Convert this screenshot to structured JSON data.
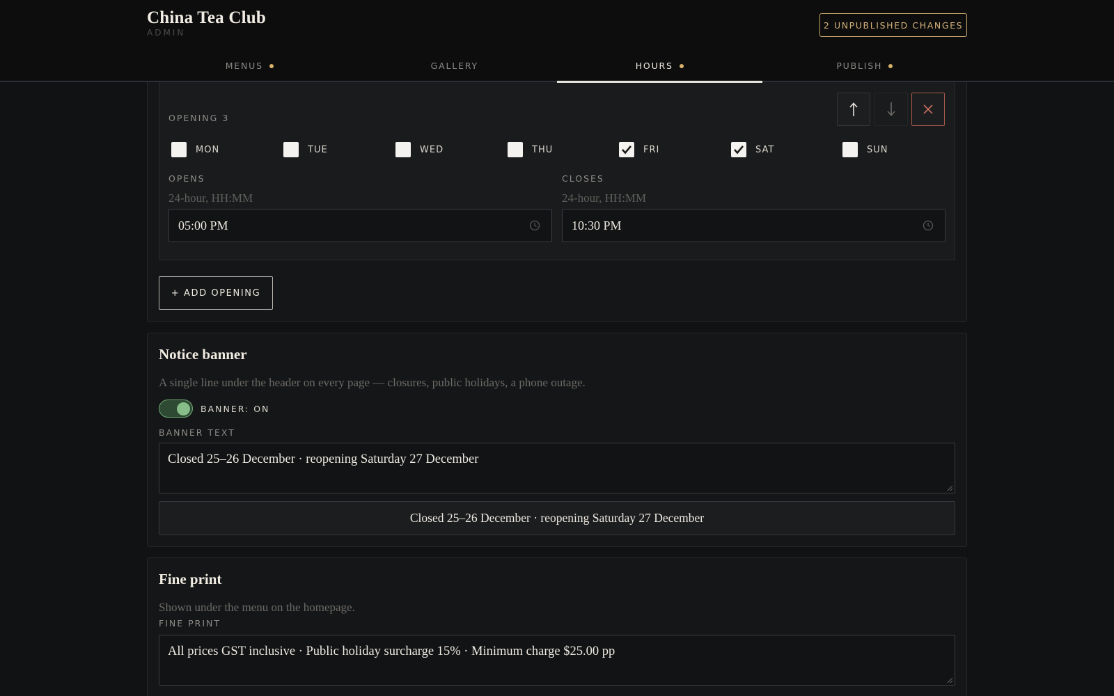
{
  "header": {
    "title": "China Tea Club",
    "subtitle": "ADMIN",
    "unpublished_label": "2 UNPUBLISHED CHANGES"
  },
  "tabs": [
    {
      "label": "MENUS",
      "has_changes": true
    },
    {
      "label": "GALLERY",
      "has_changes": false
    },
    {
      "label": "HOURS",
      "has_changes": true,
      "active": true
    },
    {
      "label": "PUBLISH",
      "has_changes": true
    }
  ],
  "opening": {
    "label": "OPENING 3",
    "days": [
      {
        "label": "MON",
        "checked": false
      },
      {
        "label": "TUE",
        "checked": false
      },
      {
        "label": "WED",
        "checked": false
      },
      {
        "label": "THU",
        "checked": false
      },
      {
        "label": "FRI",
        "checked": true
      },
      {
        "label": "SAT",
        "checked": true
      },
      {
        "label": "SUN",
        "checked": false
      }
    ],
    "opens_label": "OPENS",
    "opens_hint": "24-hour, HH:MM",
    "opens_value": "05:00 PM",
    "closes_label": "CLOSES",
    "closes_hint": "24-hour, HH:MM",
    "closes_value": "10:30 PM",
    "icons": [
      "arrow-up-icon",
      "arrow-down-icon",
      "close-icon",
      "clock-icon"
    ]
  },
  "add_opening_label": "+ ADD OPENING",
  "notice": {
    "title": "Notice banner",
    "description": "A single line under the header on every page — closures, public holidays, a phone outage.",
    "toggle_label": "BANNER: ON",
    "toggle_on": true,
    "text_label": "BANNER TEXT",
    "text_value": "Closed 25–26 December · reopening Saturday 27 December",
    "preview": "Closed 25–26 December · reopening Saturday 27 December"
  },
  "fine_print": {
    "title": "Fine print",
    "description": "Shown under the menu on the homepage.",
    "label": "FINE PRINT",
    "value": "All prices GST inclusive · Public holiday surcharge 15% · Minimum charge $25.00 pp"
  },
  "colors": {
    "background": "#111213",
    "accent_gold": "#d4b078",
    "toggle_green": "#86bd89",
    "danger": "#a65a4c"
  }
}
